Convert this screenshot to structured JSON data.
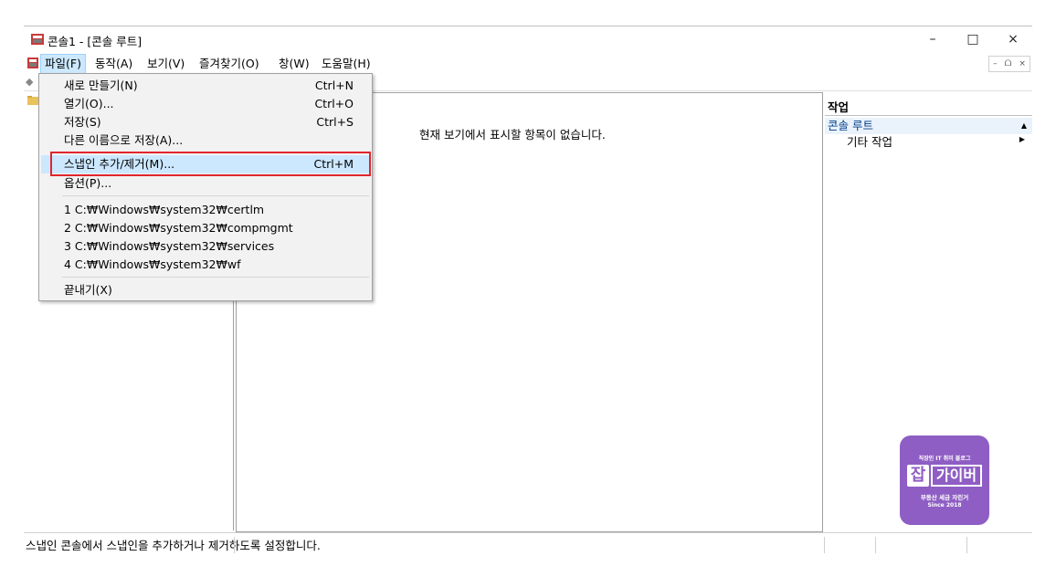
{
  "window": {
    "title": "콘솔1 - [콘솔 루트]",
    "minimize": "–",
    "maximize": "□",
    "close": "×"
  },
  "menubar": {
    "items": [
      {
        "label": "파일(F)"
      },
      {
        "label": "동작(A)"
      },
      {
        "label": "보기(V)"
      },
      {
        "label": "즐겨찾기(O)"
      },
      {
        "label": "창(W)"
      },
      {
        "label": "도움말(H)"
      }
    ],
    "mdi": {
      "minimize": "–",
      "restore": "ᗝ",
      "close": "×"
    }
  },
  "file_menu": {
    "items": [
      {
        "label": "새로 만들기(N)",
        "shortcut": "Ctrl+N"
      },
      {
        "label": "열기(O)...",
        "shortcut": "Ctrl+O"
      },
      {
        "label": "저장(S)",
        "shortcut": "Ctrl+S"
      },
      {
        "label": "다른 이름으로 저장(A)..."
      },
      {
        "label": "스냅인 추가/제거(M)...",
        "shortcut": "Ctrl+M"
      },
      {
        "label": "옵션(P)..."
      },
      {
        "label": "1 C:₩Windows₩system32₩certlm"
      },
      {
        "label": "2 C:₩Windows₩system32₩compmgmt"
      },
      {
        "label": "3 C:₩Windows₩system32₩services"
      },
      {
        "label": "4 C:₩Windows₩system32₩wf"
      },
      {
        "label": "끝내기(X)"
      }
    ]
  },
  "center": {
    "empty_message": "현재 보기에서 표시할 항목이 없습니다."
  },
  "actions": {
    "header": "작업",
    "root": "콘솔 루트",
    "more": "기타 작업"
  },
  "status": {
    "text": "스냅인 콘솔에서 스냅인을 추가하거나 제거하도록 설정합니다."
  },
  "logo": {
    "top": "직장인 IT 취미 블로그",
    "jab": "잡",
    "name": "가이버",
    "sub": "부동산 세금 자린거",
    "since": "Since 2018"
  },
  "colors": {
    "highlight": "#cce8ff",
    "red_box": "#e0262d",
    "logo_bg": "#8f5ec4"
  }
}
